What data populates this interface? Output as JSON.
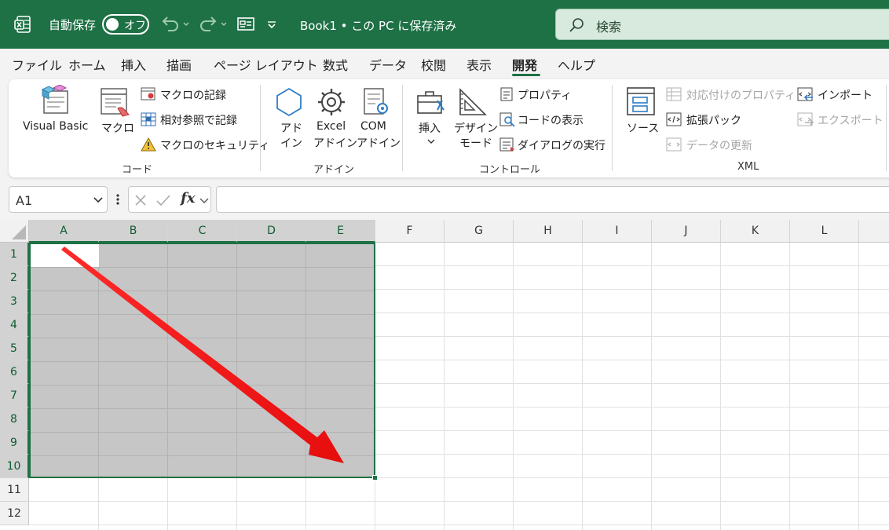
{
  "titlebar": {
    "autosave_label": "自動保存",
    "autosave_state": "オフ",
    "document_title": "Book1 • この PC に保存済み",
    "search_placeholder": "検索"
  },
  "menu_tabs": [
    "ファイル",
    "ホーム",
    "挿入",
    "描画",
    "ページ レイアウト",
    "数式",
    "データ",
    "校閲",
    "表示",
    "開発",
    "ヘルプ"
  ],
  "active_tab": "開発",
  "ribbon": {
    "code": {
      "group_label": "コード",
      "visual_basic": "Visual Basic",
      "macro": "マクロ",
      "record_macro": "マクロの記録",
      "relative_ref": "相対参照で記録",
      "macro_security": "マクロのセキュリティ"
    },
    "addins": {
      "group_label": "アドイン",
      "addin_line1": "アド",
      "addin_line2": "イン",
      "excel_line1": "Excel",
      "excel_line2": "アドイン",
      "com_line1": "COM",
      "com_line2": "アドイン"
    },
    "controls": {
      "group_label": "コントロール",
      "insert": "挿入",
      "design_line1": "デザイン",
      "design_line2": "モード",
      "properties": "プロパティ",
      "view_code": "コードの表示",
      "run_dialog": "ダイアログの実行"
    },
    "xml": {
      "group_label": "XML",
      "source": "ソース",
      "map_properties": "対応付けのプロパティ",
      "expansion_packs": "拡張パック",
      "refresh_data": "データの更新",
      "import": "インポート",
      "export": "エクスポート"
    }
  },
  "formula_bar": {
    "name_box": "A1",
    "fx_label": "fx",
    "formula_value": ""
  },
  "sheet": {
    "columns": [
      "A",
      "B",
      "C",
      "D",
      "E",
      "F",
      "G",
      "H",
      "I",
      "J",
      "K",
      "L"
    ],
    "rows": [
      "1",
      "2",
      "3",
      "4",
      "5",
      "6",
      "7",
      "8",
      "9",
      "10",
      "11",
      "12"
    ],
    "selected_range": "A1:E10",
    "active_cell": "A1"
  },
  "colors": {
    "accent": "#1e7145",
    "arrow": "#ee1111",
    "selection": "#c6c6c6"
  }
}
